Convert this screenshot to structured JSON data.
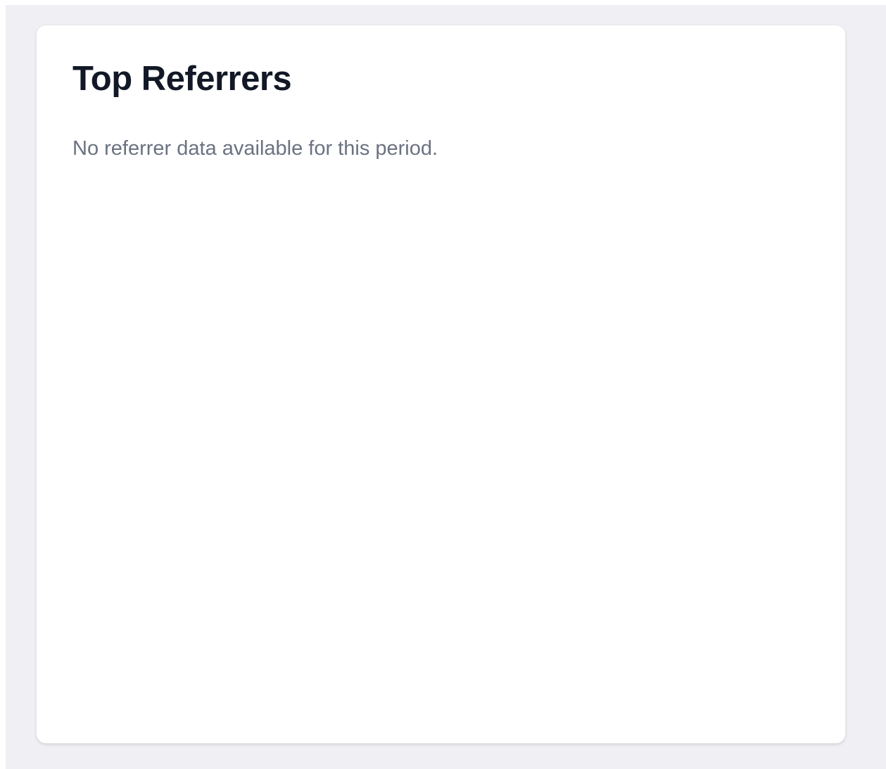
{
  "card": {
    "title": "Top Referrers",
    "empty_message": "No referrer data available for this period."
  },
  "colors": {
    "page_background": "#f0f0f4",
    "card_background": "#ffffff",
    "title_text": "#121826",
    "muted_text": "#6b7280"
  }
}
